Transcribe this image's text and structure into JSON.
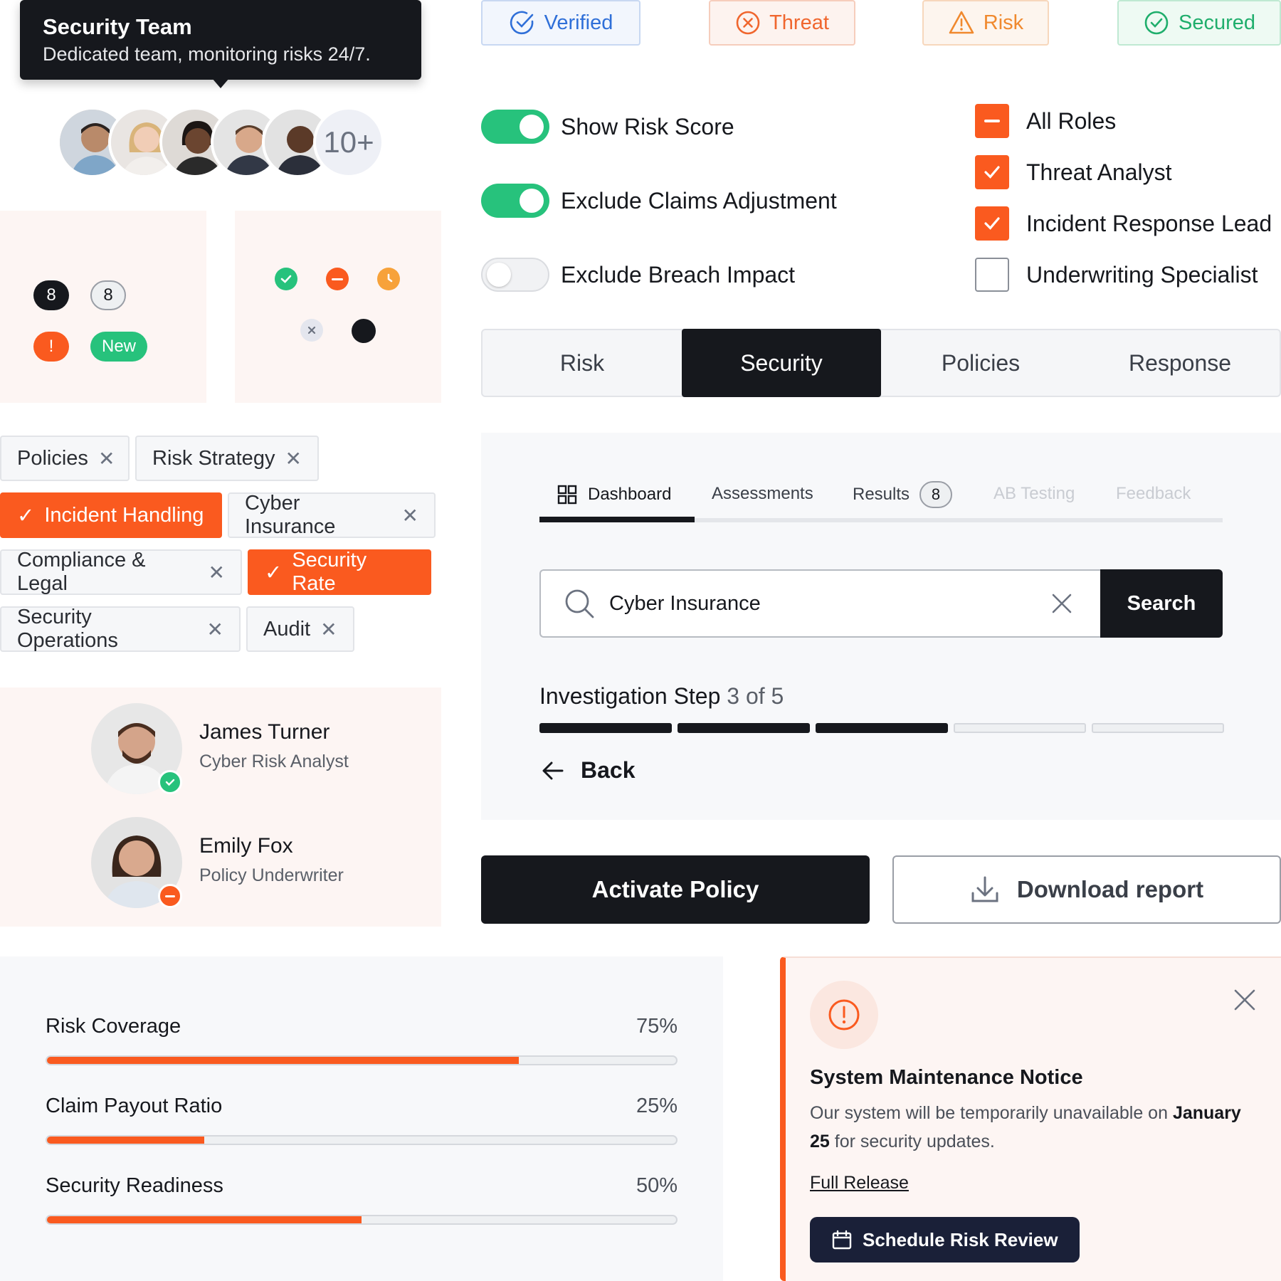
{
  "tooltip": {
    "title": "Security Team",
    "text": "Dedicated team, monitoring risks 24/7."
  },
  "avatar_group": {
    "more": "10+"
  },
  "badges": {
    "count_dark": "8",
    "count_light": "8",
    "alert": "!",
    "new": "New"
  },
  "chips": [
    {
      "label": "Policies",
      "selected": false
    },
    {
      "label": "Risk Strategy",
      "selected": false
    },
    {
      "label": "Incident Handling",
      "selected": true
    },
    {
      "label": "Cyber Insurance",
      "selected": false
    },
    {
      "label": "Compliance & Legal",
      "selected": false
    },
    {
      "label": "Security Rate",
      "selected": true
    },
    {
      "label": "Security Operations",
      "selected": false
    },
    {
      "label": "Audit",
      "selected": false
    }
  ],
  "people": [
    {
      "name": "James Turner",
      "role": "Cyber Risk Analyst",
      "status": "online"
    },
    {
      "name": "Emily Fox",
      "role": "Policy Underwriter",
      "status": "busy"
    }
  ],
  "status_pills": [
    {
      "label": "Verified",
      "icon": "check-circle-icon",
      "color": "#2f6fd8"
    },
    {
      "label": "Threat",
      "icon": "x-circle-icon",
      "color": "#f0662e"
    },
    {
      "label": "Risk",
      "icon": "warning-triangle-icon",
      "color": "#f0892e"
    },
    {
      "label": "Secured",
      "icon": "check-circle-icon",
      "color": "#1fae6c"
    }
  ],
  "toggles": [
    {
      "label": "Show Risk Score",
      "on": true
    },
    {
      "label": "Exclude Claims Adjustment",
      "on": true
    },
    {
      "label": "Exclude Breach Impact",
      "on": false
    }
  ],
  "checkboxes": [
    {
      "label": "All Roles",
      "state": "indeterminate"
    },
    {
      "label": "Threat Analyst",
      "state": "checked"
    },
    {
      "label": "Incident Response Lead",
      "state": "checked"
    },
    {
      "label": "Underwriting Specialist",
      "state": "unchecked"
    }
  ],
  "segmented_tabs": {
    "items": [
      "Risk",
      "Security",
      "Policies",
      "Response"
    ],
    "active": "Security"
  },
  "underline_tabs": {
    "items": [
      {
        "label": "Dashboard",
        "active": true
      },
      {
        "label": "Assessments"
      },
      {
        "label": "Results",
        "count": "8"
      },
      {
        "label": "AB Testing",
        "disabled": true
      },
      {
        "label": "Feedback",
        "disabled": true
      }
    ]
  },
  "search": {
    "value": "Cyber Insurance",
    "button": "Search"
  },
  "stepper": {
    "label": "Investigation Step",
    "progress": "3 of 5",
    "current": 3,
    "total": 5,
    "back": "Back"
  },
  "actions": {
    "primary": "Activate Policy",
    "secondary": "Download report"
  },
  "progress": [
    {
      "label": "Risk Coverage",
      "percent_text": "75%",
      "value": 0.75
    },
    {
      "label": "Claim Payout Ratio",
      "percent_text": "25%",
      "value": 0.25
    },
    {
      "label": "Security Readiness",
      "percent_text": "50%",
      "value": 0.5
    }
  ],
  "notice": {
    "title": "System Maintenance Notice",
    "text_before": "Our system will be temporarily unavailable on",
    "text_bold": "January 25",
    "text_after": "for security updates.",
    "link": "Full Release",
    "button": "Schedule Risk Review"
  },
  "colors": {
    "accent": "#fa5a1f",
    "dark": "#16181d",
    "success": "#27c27c"
  }
}
